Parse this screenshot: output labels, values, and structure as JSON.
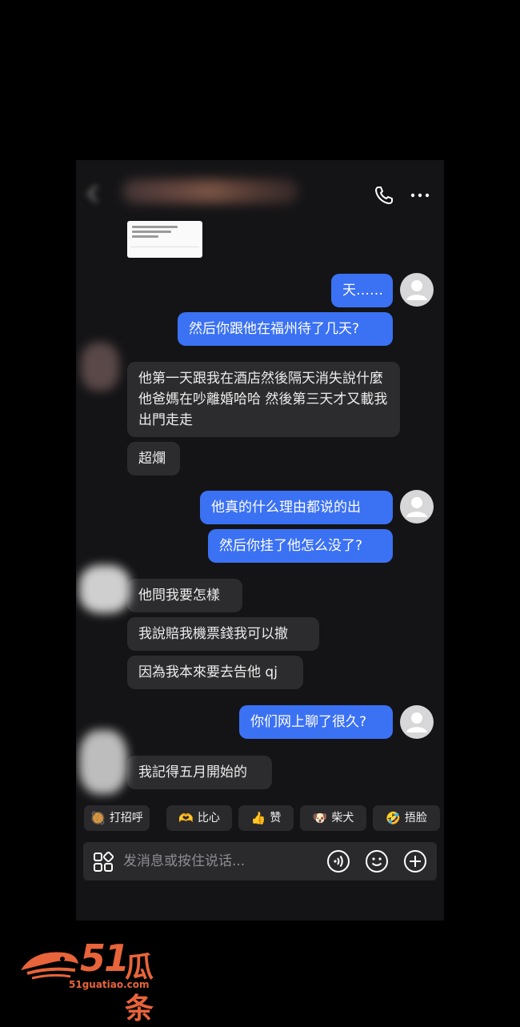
{
  "header": {
    "call_icon": "phone-icon",
    "more_icon": "more-icon"
  },
  "messages": [
    {
      "side": "out",
      "text": "天……"
    },
    {
      "side": "out",
      "text": "然后你跟他在福州待了几天?"
    },
    {
      "side": "in",
      "text": "他第一天跟我在酒店然後隔天消失說什麼他爸媽在吵離婚哈哈 然後第三天才又載我出門走走"
    },
    {
      "side": "in",
      "text": "超爛"
    },
    {
      "side": "out",
      "text": "他真的什么理由都说的出"
    },
    {
      "side": "out",
      "text": "然后你挂了他怎么没了?"
    },
    {
      "side": "in",
      "text": "他問我要怎樣"
    },
    {
      "side": "in",
      "text": "我說賠我機票錢我可以撤"
    },
    {
      "side": "in",
      "text": "因為我本來要去告他 qj"
    },
    {
      "side": "out",
      "text": "你们网上聊了很久?"
    },
    {
      "side": "in",
      "text": "我記得五月開始的"
    }
  ],
  "quick_replies": [
    {
      "emoji": "🥘",
      "label": "打招呼"
    },
    {
      "emoji": "🫶",
      "label": "比心"
    },
    {
      "emoji": "👍",
      "label": "赞"
    },
    {
      "emoji": "🐶",
      "label": "柴犬"
    },
    {
      "emoji": "🤣",
      "label": "捂脸"
    }
  ],
  "input": {
    "placeholder": "发消息或按住说话...",
    "apps_icon": "apps-grid-icon",
    "voice_icon": "voice-icon",
    "emoji_icon": "emoji-icon",
    "add_icon": "add-icon"
  },
  "watermark": {
    "number": "51",
    "name": "瓜条",
    "url": "51guatiao.com"
  },
  "colors": {
    "outgoing_bubble": "#3b71f3",
    "incoming_bubble": "#2c2c2f",
    "background": "#141416",
    "brand": "#e8643a"
  }
}
